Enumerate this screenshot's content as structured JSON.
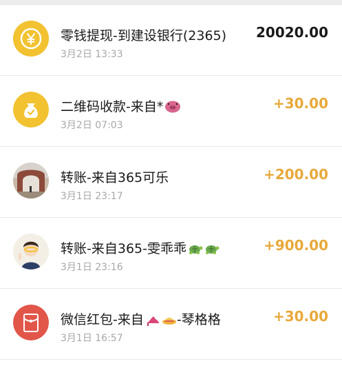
{
  "transactions": [
    {
      "title": "零钱提现-到建设银行(2365)",
      "time": "3月2日 13:33",
      "amount": "20020.00",
      "icon": "yen-coin-icon",
      "amount_color": "#1a1a1a"
    },
    {
      "title": "二维码收款-来自*",
      "time": "3月2日 07:03",
      "amount": "+30.00",
      "icon": "money-bag-icon",
      "amount_color": "#e8a93b"
    },
    {
      "title": "转账-来自365可乐",
      "time": "3月1日 23:17",
      "amount": "+200.00",
      "icon": "archway-photo-avatar",
      "amount_color": "#e8a93b"
    },
    {
      "title": "转账-来自365-雯乖乖",
      "time": "3月1日 23:16",
      "amount": "+900.00",
      "icon": "child-photo-avatar",
      "amount_color": "#e8a93b"
    },
    {
      "title": "微信红包-来自",
      "title_suffix": "-琴格格",
      "time": "3月1日 16:57",
      "amount": "+30.00",
      "icon": "red-envelope-icon",
      "amount_color": "#e8a93b"
    }
  ],
  "colors": {
    "coin_yellow": "#f2c230",
    "red_packet": "#e2564a",
    "positive_amount": "#e8a93b"
  }
}
